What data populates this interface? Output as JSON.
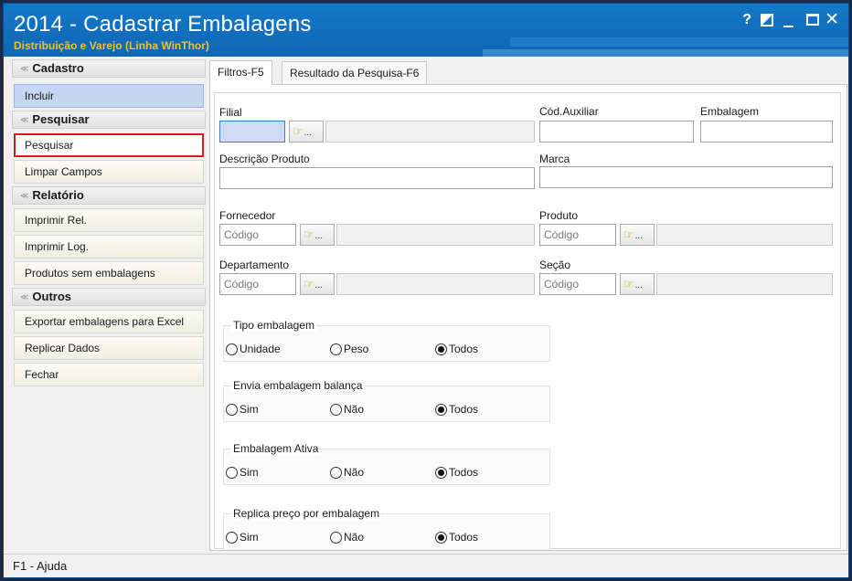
{
  "window": {
    "title": "2014 - Cadastrar Embalagens",
    "subtitle": "Distribuição e Varejo (Linha WinThor)",
    "help_glyph": "?",
    "close_glyph": "✕"
  },
  "sidebar": {
    "sections": [
      {
        "title": "Cadastro",
        "items": [
          {
            "label": "Incluir",
            "state": "active"
          }
        ]
      },
      {
        "title": "Pesquisar",
        "items": [
          {
            "label": "Pesquisar",
            "state": "highlight"
          },
          {
            "label": "Limpar Campos"
          }
        ]
      },
      {
        "title": "Relatório",
        "items": [
          {
            "label": "Imprimir Rel."
          },
          {
            "label": "Imprimir Log."
          },
          {
            "label": "Produtos sem embalagens"
          }
        ]
      },
      {
        "title": "Outros",
        "items": [
          {
            "label": "Exportar embalagens para Excel"
          },
          {
            "label": "Replicar Dados"
          },
          {
            "label": "Fechar"
          }
        ]
      }
    ]
  },
  "tabs": [
    {
      "label": "Filtros-F5",
      "active": true
    },
    {
      "label": "Resultado da Pesquisa-F6",
      "active": false
    }
  ],
  "form": {
    "filial_label": "Filial",
    "cod_aux_label": "Cód.Auxiliar",
    "embalagem_label": "Embalagem",
    "descricao_label": "Descrição Produto",
    "marca_label": "Marca",
    "fornecedor_label": "Fornecedor",
    "produto_label": "Produto",
    "departamento_label": "Departamento",
    "secao_label": "Seção",
    "code_placeholder": "Código",
    "lookup_hand": "☞",
    "lookup_dots": "..."
  },
  "groups": [
    {
      "title": "Tipo embalagem",
      "options": [
        "Unidade",
        "Peso",
        "Todos"
      ],
      "selected": 2
    },
    {
      "title": "Envia embalagem balança",
      "options": [
        "Sim",
        "Não",
        "Todos"
      ],
      "selected": 2
    },
    {
      "title": "Embalagem Ativa",
      "options": [
        "Sim",
        "Não",
        "Todos"
      ],
      "selected": 2
    },
    {
      "title": "Replica preço por embalagem",
      "options": [
        "Sim",
        "Não",
        "Todos"
      ],
      "selected": 2
    }
  ],
  "status": {
    "help_text": "F1 - Ajuda"
  }
}
